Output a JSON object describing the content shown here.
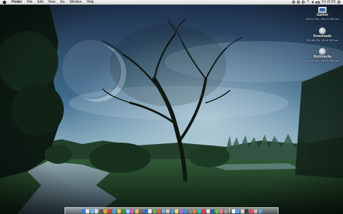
{
  "menubar": {
    "app_name": "Finder",
    "menus": [
      "File",
      "Edit",
      "View",
      "Go",
      "Window",
      "Help"
    ],
    "clock": "Fri 21:03"
  },
  "desktop_icons": [
    {
      "name": "Gaxton",
      "info": "403.12 GB, 154.21 GB free"
    },
    {
      "name": "Downloads",
      "info": "232.89 GB, 194.8 GB free"
    },
    {
      "name": "Multimedia",
      "info": "931.52 GB, 196.06 GB free"
    }
  ],
  "dock": {
    "app_colors": [
      "#2f7bd6",
      "#e8e8e8",
      "#6fb3f0",
      "#d9d9d9",
      "#5a5a5a",
      "#e9a23b",
      "#c94040",
      "#4aa0e0",
      "#e5c34a",
      "#3a8f3a",
      "#9bd0ff",
      "#d25cc4",
      "#ffb84d",
      "#6e6e6e",
      "#3c70c6",
      "#f0f0f0",
      "#5fb05f",
      "#e85a3a",
      "#7fa9d8",
      "#c8c8c8",
      "#3da6c9",
      "#f5d76e",
      "#ad6fe0",
      "#4e8cd8",
      "#8a8a8a",
      "#e27f3a",
      "#4bb3a5",
      "#d43c5b",
      "#e0e0e0",
      "#2e5fa8",
      "#7ac143",
      "#f07a9b",
      "#9e9e9e",
      "#f2f2f2",
      "#58a4e6",
      "#cfcfcf",
      "#3b3b3b",
      "#e84d4d",
      "#bdbdbd",
      "#6a9fd4"
    ]
  }
}
